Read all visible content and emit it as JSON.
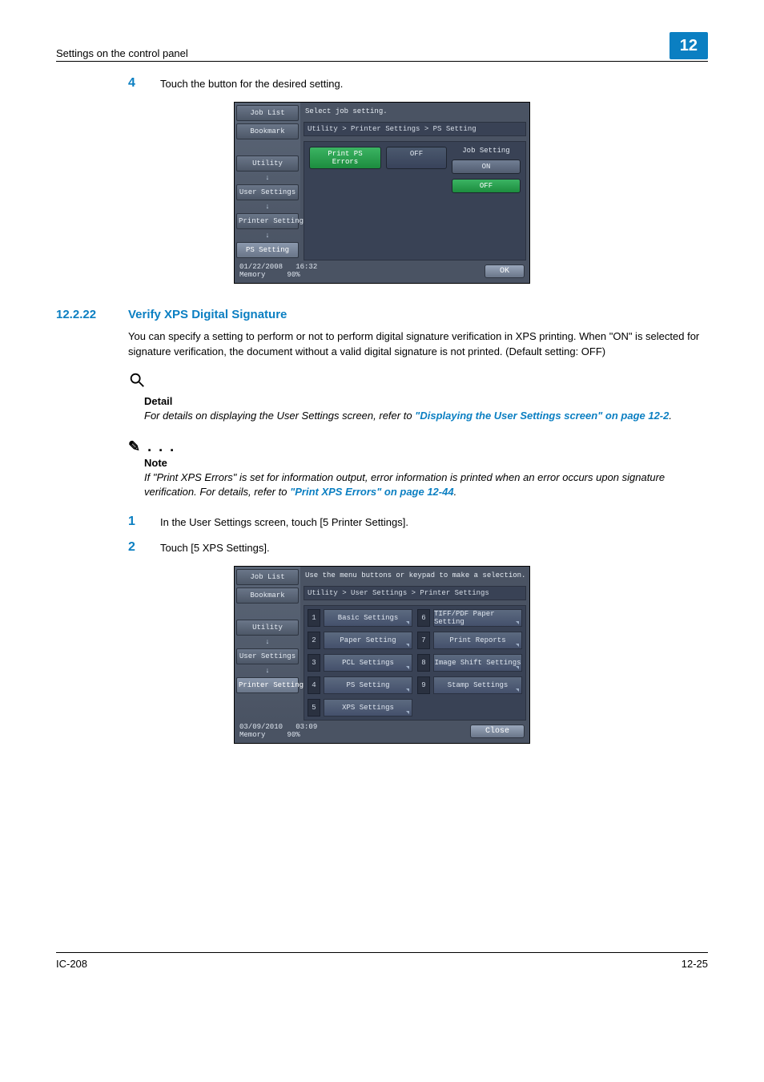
{
  "page": {
    "header_text": "Settings on the control panel",
    "chapter_badge": "12",
    "footer_left": "IC-208",
    "footer_right": "12-25"
  },
  "step4": {
    "num": "4",
    "text": "Touch the button for the desired setting."
  },
  "section": {
    "number": "12.2.22",
    "title": "Verify XPS Digital Signature",
    "paragraph": "You can specify a setting to perform or not to perform digital signature verification in XPS printing. When \"ON\" is selected for signature verification, the document without a valid digital signature is not printed. (Default setting: OFF)"
  },
  "detail": {
    "title": "Detail",
    "body_prefix": "For details on displaying the User Settings screen, refer to ",
    "link": "\"Displaying the User Settings screen\" on page 12-2",
    "body_suffix": "."
  },
  "note": {
    "title": "Note",
    "body_prefix": "If \"Print XPS Errors\" is set for information output, error information is printed when an error occurs upon signature verification. For details, refer to ",
    "link": "\"Print XPS Errors\" on page 12-44",
    "body_suffix": "."
  },
  "step1": {
    "num": "1",
    "text": "In the User Settings screen, touch [5 Printer Settings]."
  },
  "step2": {
    "num": "2",
    "text": "Touch [5 XPS Settings]."
  },
  "shot1": {
    "tabs": {
      "job_list": "Job List",
      "bookmark": "Bookmark",
      "utility": "Utility",
      "user_settings": "User Settings",
      "printer_settings": "Printer Settings",
      "ps_setting": "PS Setting"
    },
    "instruction": "Select job setting.",
    "breadcrumb": "Utility > Printer Settings > PS Setting",
    "setting_name": "Print PS Errors",
    "setting_value": "OFF",
    "job_setting_label": "Job Setting",
    "on_label": "ON",
    "off_label": "OFF",
    "date": "01/22/2008",
    "time": "16:32",
    "memory": "Memory",
    "mem_pct": "90%",
    "ok": "OK"
  },
  "shot2": {
    "tabs": {
      "job_list": "Job List",
      "bookmark": "Bookmark",
      "utility": "Utility",
      "user_settings": "User Settings",
      "printer_settings": "Printer Settings"
    },
    "instruction": "Use the menu buttons or keypad to make a selection.",
    "breadcrumb": "Utility > User Settings > Printer Settings",
    "items": [
      {
        "n": "1",
        "label": "Basic Settings"
      },
      {
        "n": "2",
        "label": "Paper Setting"
      },
      {
        "n": "3",
        "label": "PCL Settings"
      },
      {
        "n": "4",
        "label": "PS Setting"
      },
      {
        "n": "5",
        "label": "XPS Settings"
      },
      {
        "n": "6",
        "label": "TIFF/PDF Paper Setting"
      },
      {
        "n": "7",
        "label": "Print Reports"
      },
      {
        "n": "8",
        "label": "Image Shift Settings"
      },
      {
        "n": "9",
        "label": "Stamp Settings"
      }
    ],
    "date": "03/09/2010",
    "time": "03:09",
    "memory": "Memory",
    "mem_pct": "90%",
    "close": "Close"
  }
}
